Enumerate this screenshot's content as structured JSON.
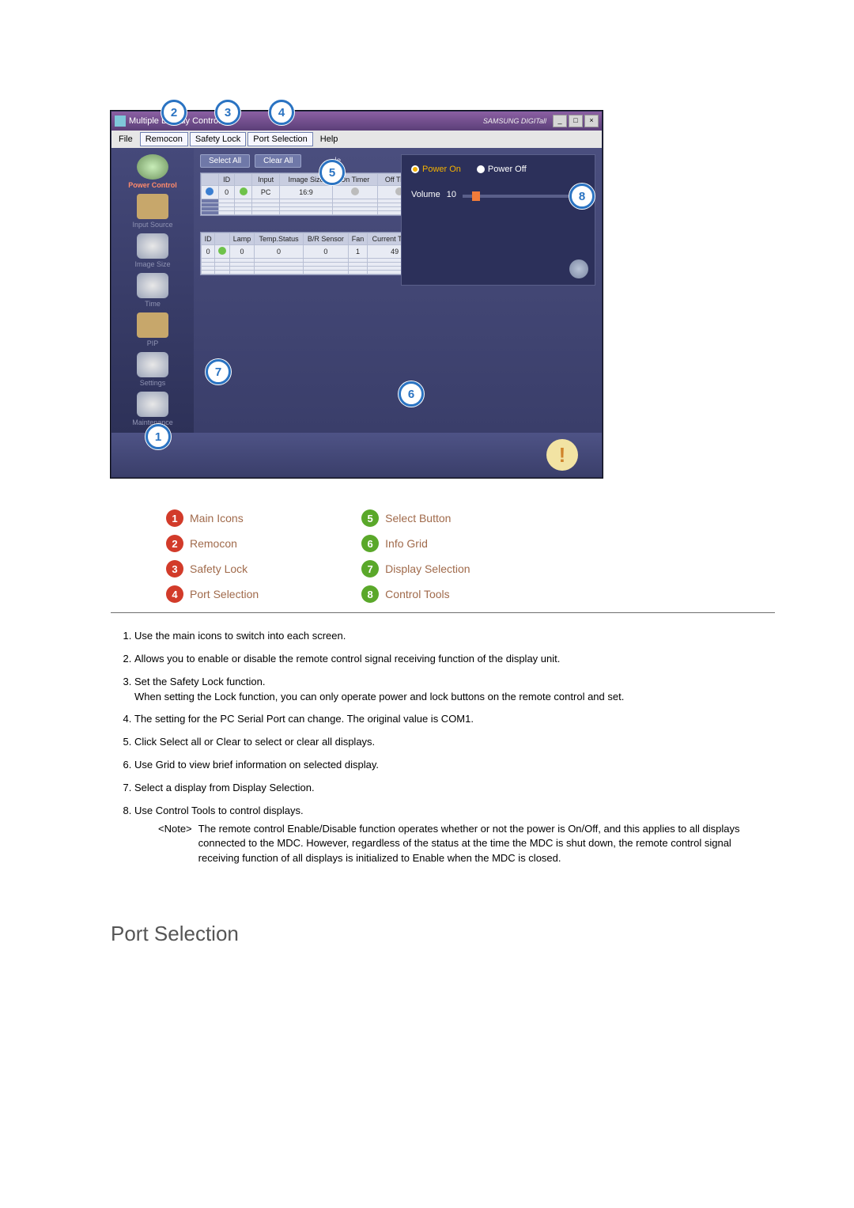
{
  "window": {
    "title": "Multiple Display Control",
    "brand": "SAMSUNG DIGITall",
    "win_buttons": {
      "min": "_",
      "max": "□",
      "close": "×"
    }
  },
  "menu": {
    "file": "File",
    "remocon": "Remocon",
    "safety_lock": "Safety Lock",
    "port_selection": "Port Selection",
    "help": "Help"
  },
  "sidebar": {
    "items": [
      {
        "label": "Power Control"
      },
      {
        "label": "Input Source"
      },
      {
        "label": "Image Size"
      },
      {
        "label": "Time"
      },
      {
        "label": "PIP"
      },
      {
        "label": "Settings"
      },
      {
        "label": "Maintenance"
      }
    ]
  },
  "toolbar": {
    "select_all": "Select All",
    "clear_all": "Clear All",
    "ie_suffix": "le"
  },
  "grid_top": {
    "headers": [
      "",
      "ID",
      "",
      "Input",
      "Image Size",
      "On Timer",
      "Off Timer"
    ],
    "row": {
      "id": "0",
      "input": "PC",
      "image_size": "16:9"
    }
  },
  "grid_bottom": {
    "headers": [
      "ID",
      "",
      "Lamp",
      "Temp.Status",
      "B/R Sensor",
      "Fan",
      "Current Temp."
    ],
    "row": {
      "id": "0",
      "lamp": "0",
      "temp_status": "0",
      "br": "0",
      "fan": "1",
      "cur_temp": "49"
    }
  },
  "panel": {
    "power_on": "Power On",
    "power_off": "Power Off",
    "volume_label": "Volume",
    "volume_value": "10"
  },
  "callouts": {
    "c1": "1",
    "c2": "2",
    "c3": "3",
    "c4": "4",
    "c5": "5",
    "c6": "6",
    "c7": "7",
    "c8": "8"
  },
  "legend": {
    "left": [
      {
        "n": "1",
        "label": "Main Icons"
      },
      {
        "n": "2",
        "label": "Remocon"
      },
      {
        "n": "3",
        "label": "Safety Lock"
      },
      {
        "n": "4",
        "label": "Port Selection"
      }
    ],
    "right": [
      {
        "n": "5",
        "label": "Select Button"
      },
      {
        "n": "6",
        "label": "Info Grid"
      },
      {
        "n": "7",
        "label": "Display Selection"
      },
      {
        "n": "8",
        "label": "Control Tools"
      }
    ]
  },
  "body_notes": {
    "n1": "Use the main icons to switch into each screen.",
    "n2": "Allows you to enable or disable the remote control signal receiving function of the display unit.",
    "n3a": "Set the Safety Lock function.",
    "n3b": "When setting the Lock function, you can only operate power and lock buttons on the remote control and set.",
    "n4": "The setting for the PC Serial Port can change. The original value is COM1.",
    "n5": "Click Select all or Clear to select or clear all displays.",
    "n6": "Use Grid to view brief information on selected display.",
    "n7": "Select a display from Display Selection.",
    "n8": "Use Control Tools to control displays.",
    "note_tag": "<Note>",
    "note_body": "The remote control Enable/Disable function operates whether or not the power is On/Off, and this applies to all displays connected to the MDC. However, regardless of the status at the time the MDC is shut down, the remote control signal receiving function of all displays is initialized to Enable when the MDC is closed."
  },
  "section_heading": "Port Selection"
}
